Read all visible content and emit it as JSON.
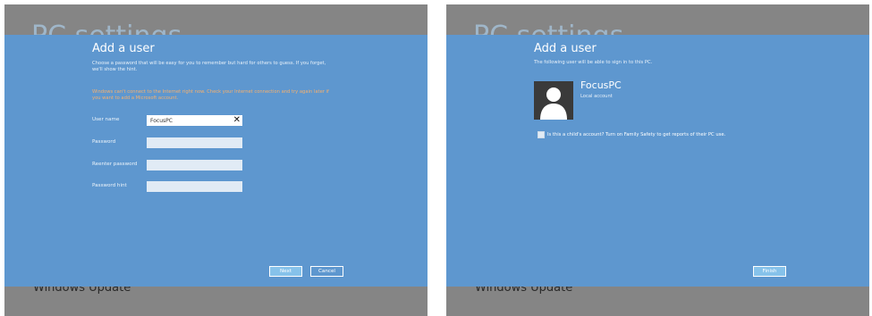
{
  "left": {
    "background_title": "PC settings",
    "background_bottom": "Windows Update",
    "dialog": {
      "title": "Add a user",
      "description": "Choose a password that will be easy for you to remember but hard for others to guess. If you forget, we'll show the hint.",
      "warning": "Windows can't connect to the Internet right now. Check your Internet connection and try again later if you want to add a Microsoft account.",
      "fields": [
        {
          "label": "User name",
          "value": "FocusPC"
        },
        {
          "label": "Password",
          "value": ""
        },
        {
          "label": "Reenter password",
          "value": ""
        },
        {
          "label": "Password hint",
          "value": ""
        }
      ],
      "clear_glyph": "✕",
      "next_label": "Next",
      "cancel_label": "Cancel"
    }
  },
  "right": {
    "background_title": "PC settings",
    "background_bottom": "Windows Update",
    "dialog": {
      "title": "Add a user",
      "subtitle": "The following user will be able to sign in to this PC.",
      "user_name": "FocusPC",
      "account_type": "Local account",
      "child_checkbox_label": "Is this a child's account? Turn on Family Safety to get reports of their PC use.",
      "finish_label": "Finish"
    }
  },
  "colors": {
    "dialog_bg": "#5e97cf",
    "primary_button": "#86c2ea",
    "warning_text": "#f6b06e",
    "panel_bg": "#858585"
  }
}
